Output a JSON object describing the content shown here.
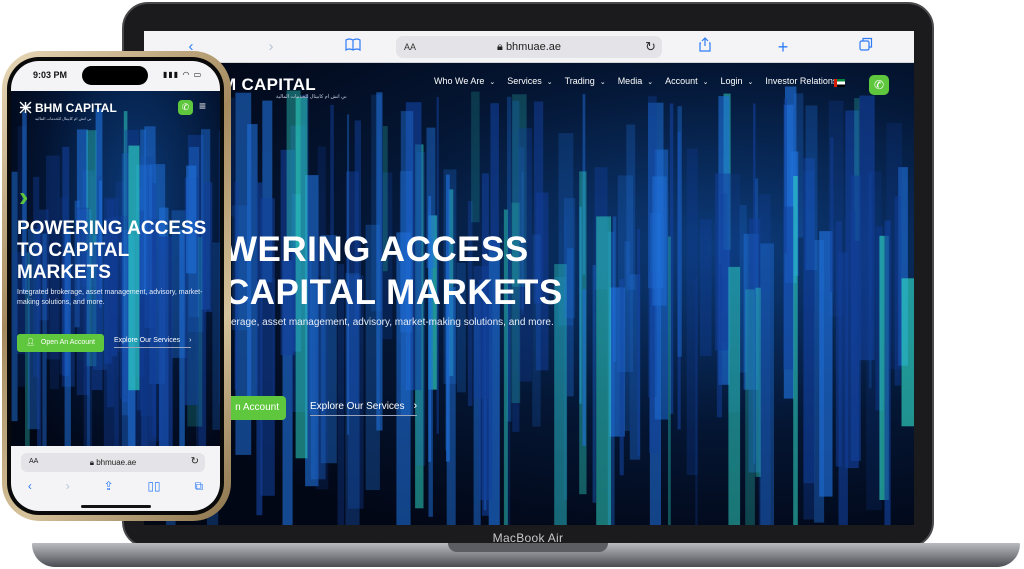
{
  "laptop": {
    "model_label": "MacBook Air",
    "browser": {
      "text_size_label": "AA",
      "url": "bhmuae.ae",
      "icons": [
        "back-icon",
        "forward-icon",
        "bookmarks-icon",
        "lock-icon",
        "reload-icon",
        "share-icon",
        "new-tab-icon",
        "tabs-icon"
      ]
    },
    "site": {
      "logo_text": "M CAPITAL",
      "logo_arabic": "بي اتش ام كابيتال للخدمات المالية",
      "nav": [
        {
          "label": "Who We Are",
          "has_dropdown": true
        },
        {
          "label": "Services",
          "has_dropdown": true
        },
        {
          "label": "Trading",
          "has_dropdown": true
        },
        {
          "label": "Media",
          "has_dropdown": true
        },
        {
          "label": "Account",
          "has_dropdown": true
        },
        {
          "label": "Login",
          "has_dropdown": true
        },
        {
          "label": "Investor Relations",
          "has_dropdown": false
        }
      ],
      "hero": {
        "title_line1": "WERING ACCESS",
        "title_line2": "CAPITAL MARKETS",
        "subtitle": "kerage, asset management, advisory, market-making solutions, and more.",
        "primary_cta": "n Account",
        "secondary_cta": "Explore Our Services"
      }
    }
  },
  "phone": {
    "status": {
      "time": "9:03 PM"
    },
    "browser": {
      "text_size_label": "AA",
      "url": "bhmuae.ae"
    },
    "site": {
      "logo_text": "BHM CAPITAL",
      "logo_arabic": "بي اتش ام كابيتال للخدمات المالية",
      "hero": {
        "title_line1": "POWERING ACCESS",
        "title_line2": "TO CAPITAL",
        "title_line3": "MARKETS",
        "subtitle": "Integrated brokerage, asset management, advisory, market-making solutions, and more.",
        "primary_cta": "Open An Account",
        "secondary_cta": "Explore Our Services"
      }
    }
  },
  "colors": {
    "accent_green": "#5fc73d",
    "hero_dark": "#020716",
    "hero_blue": "#0c3b7a",
    "safari_blue": "#2e7cf6"
  }
}
